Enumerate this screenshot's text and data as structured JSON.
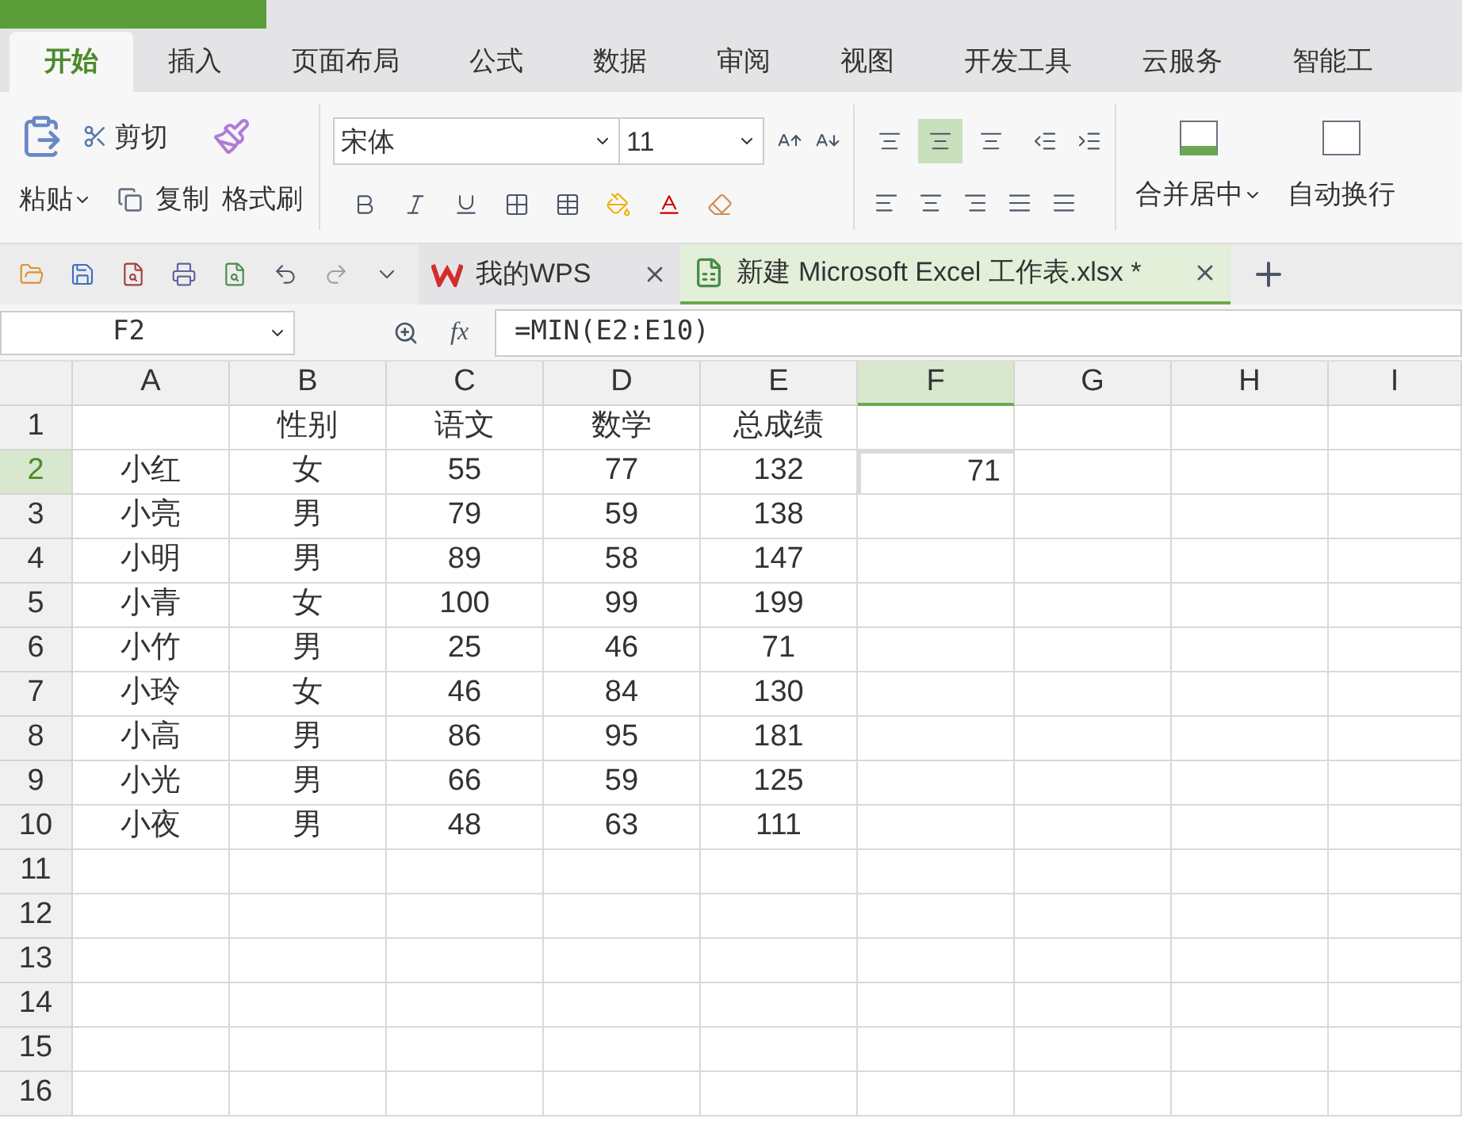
{
  "ribbon_tabs": [
    {
      "label": "开始",
      "selected": true
    },
    {
      "label": "插入",
      "selected": false
    },
    {
      "label": "页面布局",
      "selected": false
    },
    {
      "label": "公式",
      "selected": false
    },
    {
      "label": "数据",
      "selected": false
    },
    {
      "label": "审阅",
      "selected": false
    },
    {
      "label": "视图",
      "selected": false
    },
    {
      "label": "开发工具",
      "selected": false
    },
    {
      "label": "云服务",
      "selected": false
    },
    {
      "label": "智能工",
      "selected": false
    }
  ],
  "clipboard": {
    "paste": "粘贴",
    "cut": "剪切",
    "copy": "复制",
    "format_painter": "格式刷"
  },
  "font": {
    "name": "宋体",
    "size": "11"
  },
  "vertical_align": [
    {
      "selected": false
    },
    {
      "selected": true
    },
    {
      "selected": false
    }
  ],
  "merge": "合并居中",
  "wrap": "自动换行",
  "doc_tabs": [
    {
      "label": "我的WPS",
      "selected": false,
      "kind": "home"
    },
    {
      "label": "新建 Microsoft Excel 工作表.xlsx *",
      "selected": true,
      "kind": "sheet"
    }
  ],
  "name_box": "F2",
  "fx": "fx",
  "formula": "=MIN(E2:E10)",
  "columns": [
    {
      "label": "A",
      "selected": false
    },
    {
      "label": "B",
      "selected": false
    },
    {
      "label": "C",
      "selected": false
    },
    {
      "label": "D",
      "selected": false
    },
    {
      "label": "E",
      "selected": false
    },
    {
      "label": "F",
      "selected": true
    },
    {
      "label": "G",
      "selected": false
    },
    {
      "label": "H",
      "selected": false
    },
    {
      "label": "I",
      "selected": false
    }
  ],
  "rows": [
    {
      "label": "1",
      "selected": false,
      "cells": [
        "",
        "性别",
        "语文",
        "数学",
        "总成绩",
        "",
        "",
        "",
        ""
      ]
    },
    {
      "label": "2",
      "selected": true,
      "cells": [
        "小红",
        "女",
        "55",
        "77",
        "132",
        "71",
        "",
        "",
        ""
      ]
    },
    {
      "label": "3",
      "selected": false,
      "cells": [
        "小亮",
        "男",
        "79",
        "59",
        "138",
        "",
        "",
        "",
        ""
      ]
    },
    {
      "label": "4",
      "selected": false,
      "cells": [
        "小明",
        "男",
        "89",
        "58",
        "147",
        "",
        "",
        "",
        ""
      ]
    },
    {
      "label": "5",
      "selected": false,
      "cells": [
        "小青",
        "女",
        "100",
        "99",
        "199",
        "",
        "",
        "",
        ""
      ]
    },
    {
      "label": "6",
      "selected": false,
      "cells": [
        "小竹",
        "男",
        "25",
        "46",
        "71",
        "",
        "",
        "",
        ""
      ]
    },
    {
      "label": "7",
      "selected": false,
      "cells": [
        "小玲",
        "女",
        "46",
        "84",
        "130",
        "",
        "",
        "",
        ""
      ]
    },
    {
      "label": "8",
      "selected": false,
      "cells": [
        "小高",
        "男",
        "86",
        "95",
        "181",
        "",
        "",
        "",
        ""
      ]
    },
    {
      "label": "9",
      "selected": false,
      "cells": [
        "小光",
        "男",
        "66",
        "59",
        "125",
        "",
        "",
        "",
        ""
      ]
    },
    {
      "label": "10",
      "selected": false,
      "cells": [
        "小夜",
        "男",
        "48",
        "63",
        "111",
        "",
        "",
        "",
        ""
      ]
    },
    {
      "label": "11",
      "selected": false,
      "cells": [
        "",
        "",
        "",
        "",
        "",
        "",
        "",
        "",
        ""
      ]
    },
    {
      "label": "12",
      "selected": false,
      "cells": [
        "",
        "",
        "",
        "",
        "",
        "",
        "",
        "",
        ""
      ]
    },
    {
      "label": "13",
      "selected": false,
      "cells": [
        "",
        "",
        "",
        "",
        "",
        "",
        "",
        "",
        ""
      ]
    },
    {
      "label": "14",
      "selected": false,
      "cells": [
        "",
        "",
        "",
        "",
        "",
        "",
        "",
        "",
        ""
      ]
    },
    {
      "label": "15",
      "selected": false,
      "cells": [
        "",
        "",
        "",
        "",
        "",
        "",
        "",
        "",
        ""
      ]
    },
    {
      "label": "16",
      "selected": false,
      "cells": [
        "",
        "",
        "",
        "",
        "",
        "",
        "",
        "",
        ""
      ]
    }
  ]
}
